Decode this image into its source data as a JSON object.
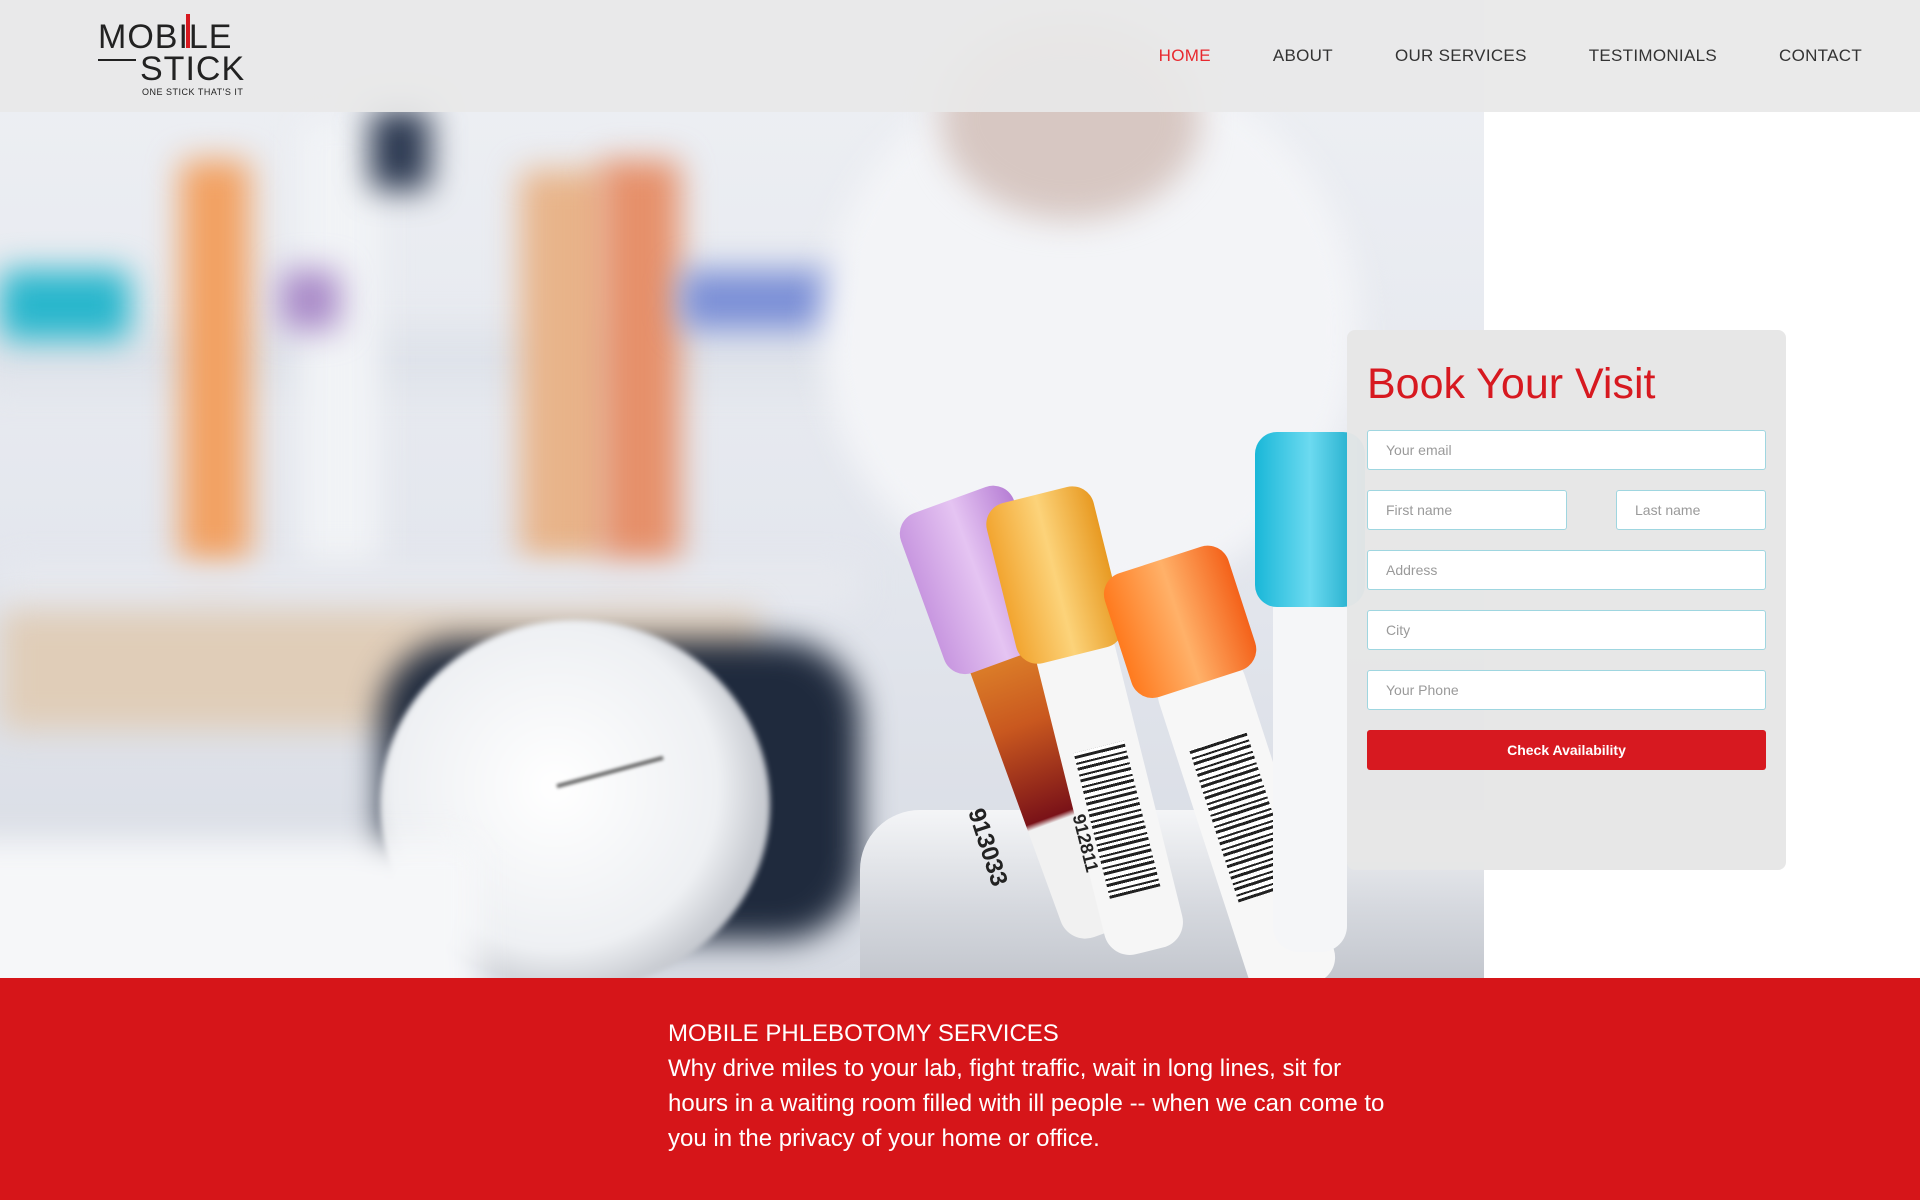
{
  "brand": {
    "name_top": "MOBILE",
    "name_bottom": "STICK",
    "tagline": "ONE STICK THAT'S IT"
  },
  "nav": {
    "items": [
      {
        "label": "HOME",
        "active": true
      },
      {
        "label": "ABOUT",
        "active": false
      },
      {
        "label": "OUR SERVICES",
        "active": false
      },
      {
        "label": "TESTIMONIALS",
        "active": false
      },
      {
        "label": "CONTACT",
        "active": false
      }
    ]
  },
  "booking": {
    "title": "Book Your Visit",
    "email_placeholder": "Your email",
    "first_name_placeholder": "First name",
    "last_name_placeholder": "Last name",
    "address_placeholder": "Address",
    "city_placeholder": "City",
    "phone_placeholder": "Your Phone",
    "submit_label": "Check Availability"
  },
  "hero": {
    "tube_labels": [
      "913033",
      "912811"
    ]
  },
  "band": {
    "heading": "MOBILE PHLEBOTOMY SERVICES",
    "body": "Why drive miles to your lab, fight traffic, wait in long lines, sit for hours in a waiting room filled with ill people -- when we can come to you in the privacy of your home or office."
  },
  "colors": {
    "brand_red": "#d71920",
    "band_red": "#d61519",
    "nav_active": "#e8282e",
    "field_border": "#9fd6e0"
  }
}
